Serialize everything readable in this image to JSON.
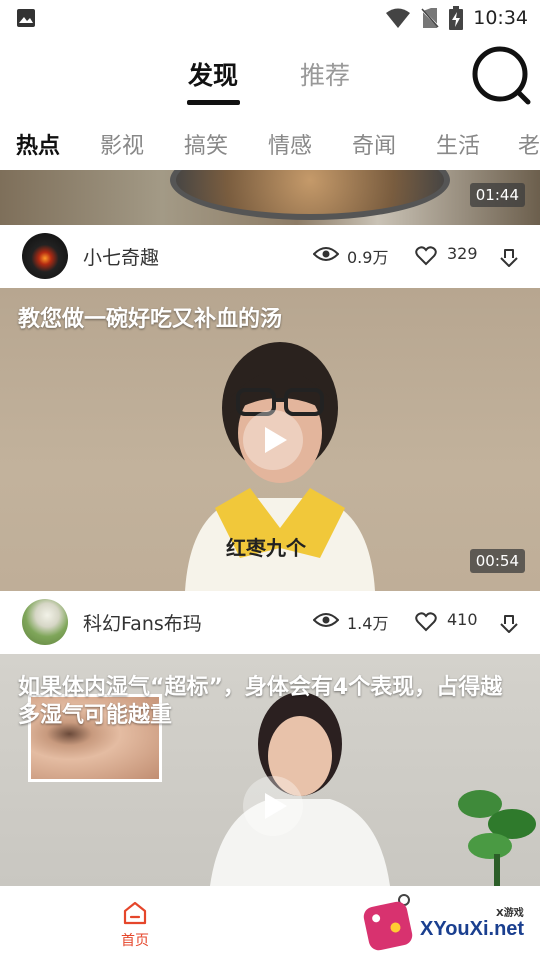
{
  "status_bar": {
    "time": "10:34"
  },
  "top_tabs": [
    {
      "label": "发现",
      "active": true
    },
    {
      "label": "推荐",
      "active": false
    }
  ],
  "categories": [
    "热点",
    "影视",
    "搞笑",
    "情感",
    "奇闻",
    "生活",
    "老"
  ],
  "feed": [
    {
      "duration": "01:44",
      "author": "小七奇趣",
      "views": "0.9万",
      "likes": "329"
    },
    {
      "title": "教您做一碗好吃又补血的汤",
      "caption": "红枣九个",
      "duration": "00:54",
      "author": "科幻Fans布玛",
      "views": "1.4万",
      "likes": "410"
    },
    {
      "title": "如果体内湿气“超标”，身体会有4个表现，占得越多湿气可能越重"
    }
  ],
  "bottom_nav": {
    "home_label": "首页"
  },
  "watermark": {
    "text": "XYouXi.net",
    "small": "X游戏"
  },
  "colors": {
    "accent": "#e5462b",
    "text_dark": "#111111",
    "text_muted": "#999999"
  }
}
